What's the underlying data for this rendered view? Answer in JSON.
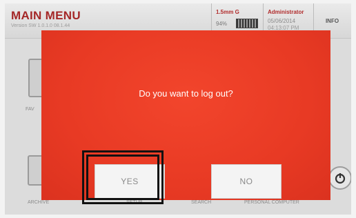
{
  "header": {
    "title": "MAIN MENU",
    "version": "Version SW 1.0.1.0 08.1.44",
    "key": "1.5mm G",
    "battery_percent": "94%",
    "user": "Administrator",
    "date": "05/06/2014",
    "time": "04:13:07 PM",
    "info_label": "INFO"
  },
  "menu": {
    "favorites": "FAV",
    "archive": "ARCHIVE",
    "setup": "SETUP",
    "search": "SEARCH",
    "personal_computer": "PERSONAL COMPUTER"
  },
  "dialog": {
    "question": "Do you want to log out?",
    "yes_label": "YES",
    "no_label": "NO"
  },
  "colors": {
    "dialog_background": "#e83a24",
    "title": "#a42727",
    "highlight_border": "#111111"
  },
  "icons": [
    "battery-icon",
    "power-icon",
    "favorites-icon",
    "archive-icon"
  ]
}
